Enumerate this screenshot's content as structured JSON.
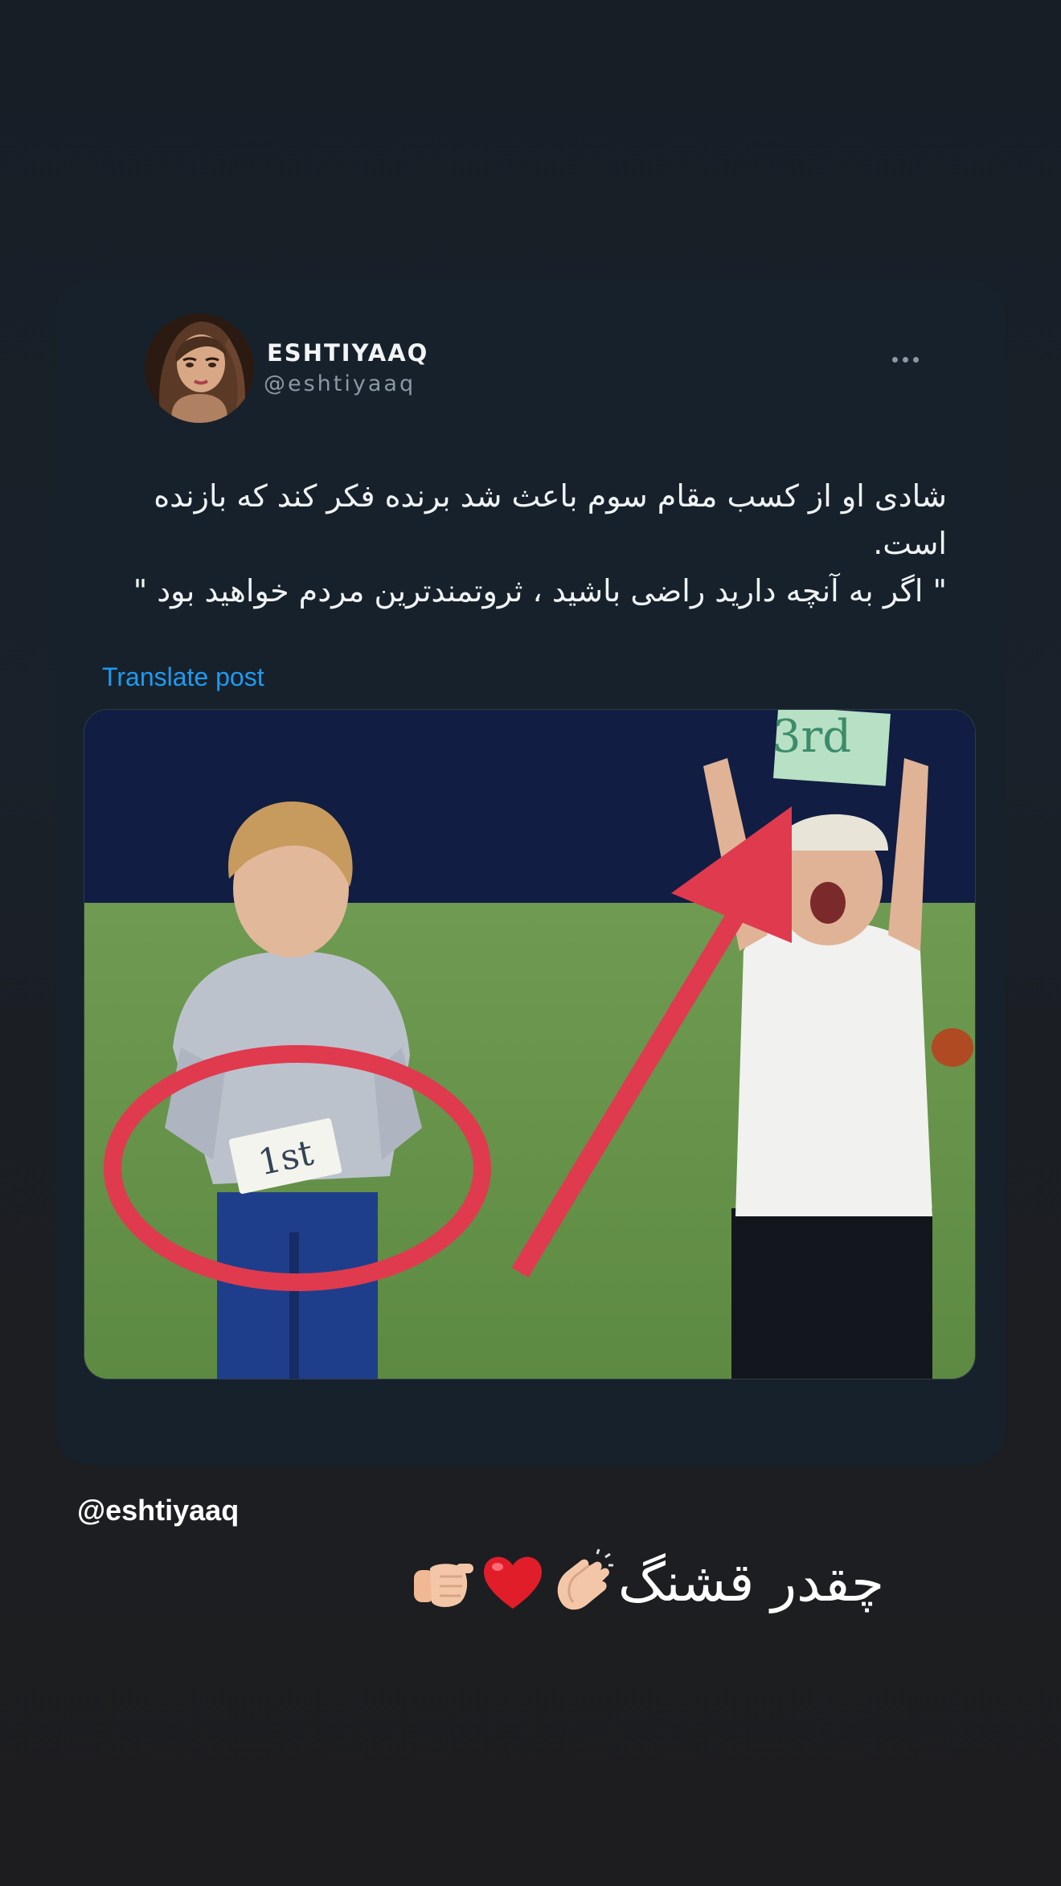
{
  "post": {
    "display_name": "ESHTIYAAQ",
    "handle": "@eshtiyaaq",
    "text_lines": [
      "شادی او از کسب مقام سوم باعث شد برنده فکر کند که بازنده",
      "است.",
      "\" اگر به آنچه دارید راضی باشید ، ثروتمندترین مردم خواهید بود \""
    ],
    "translate_label": "Translate post",
    "more_icon": "more-horizontal-icon",
    "media": {
      "badge_first": "1st",
      "badge_third": "3rd"
    }
  },
  "story": {
    "mention": "@eshtiyaaq",
    "caption": "چقدر قشنگ",
    "emojis": [
      "clapping-hands-icon",
      "red-heart-icon",
      "pointing-fist-icon"
    ]
  },
  "colors": {
    "background": "#19212a",
    "card": "#17212b",
    "link": "#1d9bf0",
    "secondary_text": "#8b98a5",
    "annotation_red": "#e03a4e"
  }
}
